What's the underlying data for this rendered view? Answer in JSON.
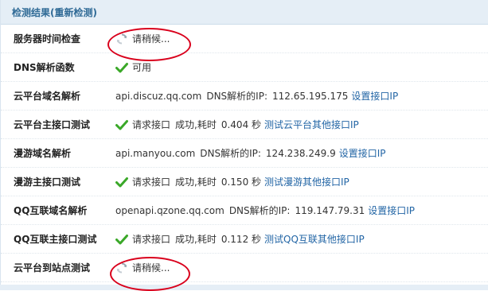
{
  "header": {
    "title": "检测结果",
    "retest_link": "(重新检测)"
  },
  "rows": [
    {
      "label": "服务器时间检查",
      "status": "请稍候..."
    },
    {
      "label": "DNS解析函数",
      "status": "可用"
    },
    {
      "label": "云平台域名解析",
      "domain": "api.discuz.qq.com",
      "resolve_text": "DNS解析的IP:",
      "ip": "112.65.195.175",
      "link": "设置接口IP"
    },
    {
      "label": "云平台主接口测试",
      "request_text": "请求接口",
      "result": "成功,耗时",
      "time": "0.404 秒",
      "link": "测试云平台其他接口IP"
    },
    {
      "label": "漫游域名解析",
      "domain": "api.manyou.com",
      "resolve_text": "DNS解析的IP:",
      "ip": "124.238.249.9",
      "link": "设置接口IP"
    },
    {
      "label": "漫游主接口测试",
      "request_text": "请求接口",
      "result": "成功,耗时",
      "time": "0.150 秒",
      "link": "测试漫游其他接口IP"
    },
    {
      "label": "QQ互联域名解析",
      "domain": "openapi.qzone.qq.com",
      "resolve_text": "DNS解析的IP:",
      "ip": "119.147.79.31",
      "link": "设置接口IP"
    },
    {
      "label": "QQ互联主接口测试",
      "request_text": "请求接口",
      "result": "成功,耗时",
      "time": "0.112 秒",
      "link": "测试QQ互联其他接口IP"
    },
    {
      "label": "云平台到站点测试",
      "status": "请稍候..."
    }
  ],
  "colors": {
    "header_bg": "#e5eef6",
    "header_text": "#2f6a96",
    "link": "#2265a5",
    "check": "#3aa828",
    "annotation_circle": "#d9001c"
  }
}
